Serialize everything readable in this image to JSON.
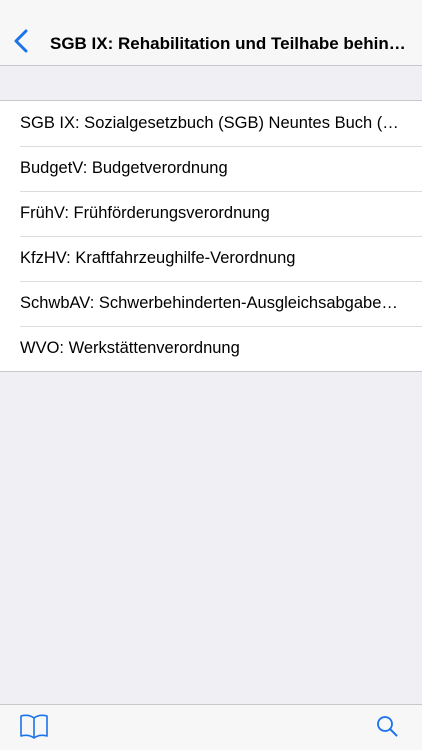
{
  "colors": {
    "accent": "#1a73e8",
    "background": "#efeff4",
    "bar_background": "#f7f7f7",
    "separator": "#c8c7cc"
  },
  "navbar": {
    "back_icon": "chevron-left-icon",
    "title": "SGB IX: Rehabilitation und Teilhabe behinderter Menschen"
  },
  "list": {
    "items": [
      {
        "label": "SGB IX: Sozialgesetzbuch (SGB) Neuntes Buch (IX) - Rehabilitation und Teilhabe behinderter Menschen"
      },
      {
        "label": "BudgetV: Budgetverordnung"
      },
      {
        "label": "FrühV: Frühförderungsverordnung"
      },
      {
        "label": "KfzHV: Kraftfahrzeughilfe-Verordnung"
      },
      {
        "label": "SchwbAV: Schwerbehinderten-Ausgleichsabgabeverordnung"
      },
      {
        "label": "WVO: Werkstättenverordnung"
      }
    ]
  },
  "tabbar": {
    "left_icon": "book-icon",
    "right_icon": "search-icon"
  }
}
